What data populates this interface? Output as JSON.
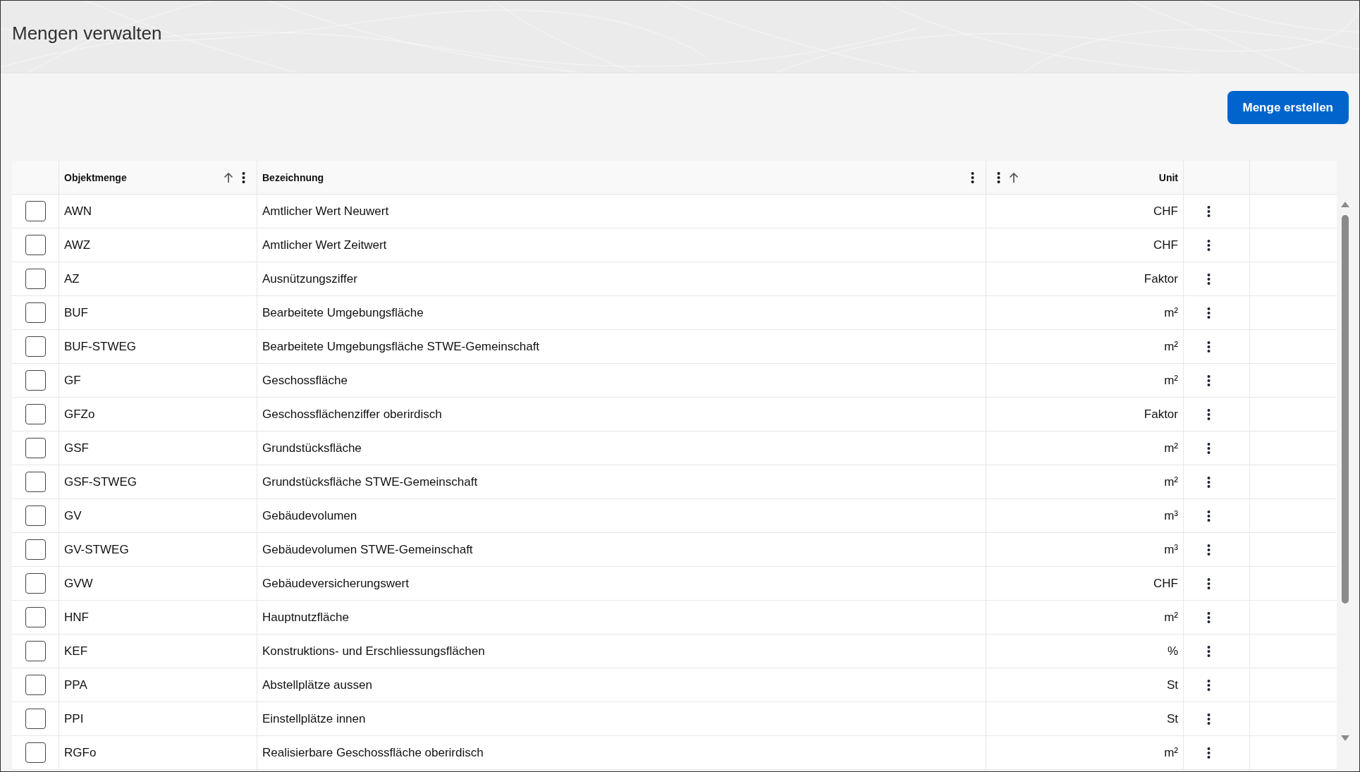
{
  "page": {
    "title": "Mengen verwalten"
  },
  "toolbar": {
    "create_button": "Menge erstellen"
  },
  "table": {
    "columns": [
      {
        "label": "Objektmenge",
        "sorted": true
      },
      {
        "label": "Bezeichnung",
        "sorted": false
      },
      {
        "label": "Unit",
        "sorted": true
      }
    ],
    "rows": [
      {
        "objektmenge": "AWN",
        "bezeichnung": "Amtlicher Wert Neuwert",
        "unit": "CHF",
        "checked": false
      },
      {
        "objektmenge": "AWZ",
        "bezeichnung": "Amtlicher Wert Zeitwert",
        "unit": "CHF",
        "checked": false
      },
      {
        "objektmenge": "AZ",
        "bezeichnung": "Ausnützungsziffer",
        "unit": "Faktor",
        "checked": false
      },
      {
        "objektmenge": "BUF",
        "bezeichnung": "Bearbeitete Umgebungsfläche",
        "unit": "m²",
        "checked": false
      },
      {
        "objektmenge": "BUF-STWEG",
        "bezeichnung": "Bearbeitete Umgebungsfläche STWE-Gemeinschaft",
        "unit": "m²",
        "checked": false
      },
      {
        "objektmenge": "GF",
        "bezeichnung": "Geschossfläche",
        "unit": "m²",
        "checked": false
      },
      {
        "objektmenge": "GFZo",
        "bezeichnung": "Geschossflächenziffer oberirdisch",
        "unit": "Faktor",
        "checked": false
      },
      {
        "objektmenge": "GSF",
        "bezeichnung": "Grundstücksfläche",
        "unit": "m²",
        "checked": false
      },
      {
        "objektmenge": "GSF-STWEG",
        "bezeichnung": "Grundstücksfläche STWE-Gemeinschaft",
        "unit": "m²",
        "checked": false
      },
      {
        "objektmenge": "GV",
        "bezeichnung": "Gebäudevolumen",
        "unit": "m³",
        "checked": false
      },
      {
        "objektmenge": "GV-STWEG",
        "bezeichnung": "Gebäudevolumen STWE-Gemeinschaft",
        "unit": "m³",
        "checked": false
      },
      {
        "objektmenge": "GVW",
        "bezeichnung": "Gebäudeversicherungswert",
        "unit": "CHF",
        "checked": false
      },
      {
        "objektmenge": "HNF",
        "bezeichnung": "Hauptnutzfläche",
        "unit": "m²",
        "checked": false
      },
      {
        "objektmenge": "KEF",
        "bezeichnung": "Konstruktions- und Erschliessungsflächen",
        "unit": "%",
        "checked": false
      },
      {
        "objektmenge": "PPA",
        "bezeichnung": "Abstellplätze aussen",
        "unit": "St",
        "checked": false
      },
      {
        "objektmenge": "PPI",
        "bezeichnung": "Einstellplätze innen",
        "unit": "St",
        "checked": false
      },
      {
        "objektmenge": "RGFo",
        "bezeichnung": "Realisierbare Geschossfläche oberirdisch",
        "unit": "m²",
        "checked": false
      }
    ]
  }
}
